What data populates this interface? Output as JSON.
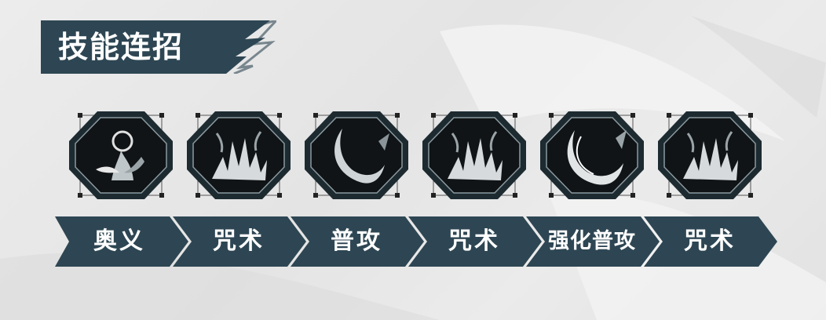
{
  "title": "技能连招",
  "colors": {
    "banner": "#2e4653",
    "icon_frame": "#1d2b31",
    "icon_inner": "#101416",
    "text": "#ffffff"
  },
  "skills": [
    {
      "label": "奥义",
      "icon": "ultimate-flame-orb-icon"
    },
    {
      "label": "咒术",
      "icon": "spell-burst-icon"
    },
    {
      "label": "普攻",
      "icon": "normal-attack-slash-icon"
    },
    {
      "label": "咒术",
      "icon": "spell-burst-icon"
    },
    {
      "label": "强化普攻",
      "icon": "enhanced-attack-slash-icon"
    },
    {
      "label": "咒术",
      "icon": "spell-burst-icon"
    }
  ]
}
